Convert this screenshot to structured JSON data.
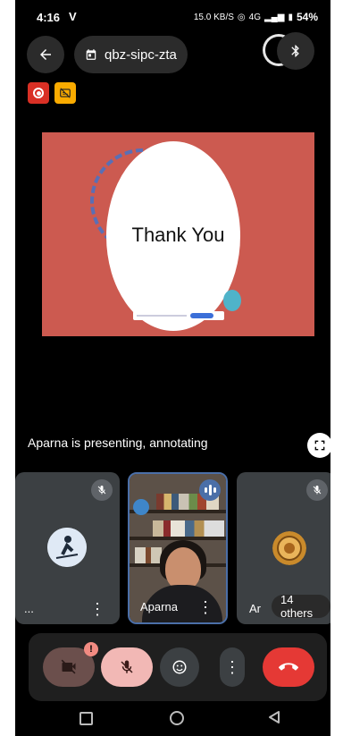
{
  "status": {
    "time": "4:16",
    "carrier_glyph": "V",
    "speed": "15.0 KB/S",
    "network": "4G",
    "battery": "54%"
  },
  "topbar": {
    "back_icon": "arrow-left-icon",
    "meeting_code": "qbz-sipc-zta",
    "bluetooth_icon": "bluetooth-icon"
  },
  "badges": {
    "recording_icon": "record-icon",
    "captions_icon": "captions-off-icon"
  },
  "slide": {
    "title": "Thank You",
    "bg_color": "#cc5a50"
  },
  "presentation": {
    "status_text": "Aparna is presenting, annotating"
  },
  "participants": [
    {
      "name": "...",
      "muted": true
    },
    {
      "name": "Aparna",
      "speaking": true
    },
    {
      "name": "Ar",
      "muted": true
    }
  ],
  "others": {
    "label": "14 others"
  },
  "controls": {
    "camera_alert": "!",
    "camera_icon": "videocam-off-icon",
    "mic_icon": "mic-off-icon",
    "reactions_icon": "emoji-icon",
    "more_icon": "more-vert-icon",
    "end_call_icon": "call-end-icon"
  },
  "colors": {
    "end_call": "#e53935",
    "mic_off_bg": "#f2b8b5",
    "accent_blue": "#4b6fa8"
  }
}
